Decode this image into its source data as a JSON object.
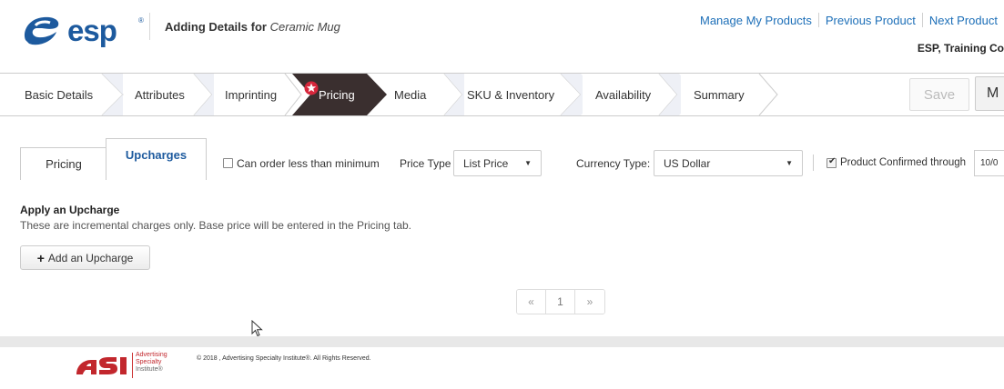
{
  "header": {
    "logo_text": "esp",
    "title_prefix": "Adding Details for",
    "product_name": "Ceramic Mug",
    "links": [
      "Manage My Products",
      "Previous Product",
      "Next Product"
    ],
    "company": "ESP, Training Co"
  },
  "wizard": {
    "steps": [
      "Basic Details",
      "Attributes",
      "Imprinting",
      "Pricing",
      "Media",
      "SKU & Inventory",
      "Availability",
      "Summary"
    ],
    "active_step": "Pricing",
    "save_label": "Save",
    "more_label": "M"
  },
  "tabs": {
    "pricing": "Pricing",
    "upcharges": "Upcharges",
    "active": "Upcharges"
  },
  "options": {
    "min_order_label": "Can order less than minimum",
    "min_order_checked": false,
    "price_type_label": "Price Type",
    "price_type_value": "List Price",
    "currency_label": "Currency Type:",
    "currency_value": "US Dollar",
    "confirmed_label": "Product Confirmed through",
    "confirmed_checked": true,
    "confirmed_date": "10/0"
  },
  "upcharge": {
    "title": "Apply an Upcharge",
    "description": "These are incremental charges only. Base price will be entered in the Pricing tab.",
    "add_button": "Add an Upcharge"
  },
  "pagination": {
    "prev": "«",
    "page": "1",
    "next": "»"
  },
  "footer": {
    "asi_line1": "Advertising",
    "asi_line2": "Specialty",
    "asi_line3": "Institute®",
    "copyright": "© 2018 , Advertising Specialty Institute®. All Rights Reserved."
  },
  "colors": {
    "brand_blue": "#1d5a9e",
    "link_blue": "#1d6fb8",
    "active_step_bg": "#3a2f2f",
    "asi_red": "#c2272d"
  }
}
